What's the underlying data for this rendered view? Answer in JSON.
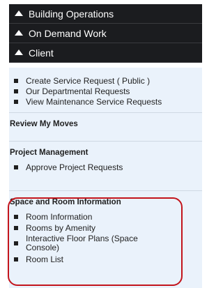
{
  "menus": [
    {
      "label": "Building Operations"
    },
    {
      "label": "On Demand Work"
    },
    {
      "label": "Client"
    }
  ],
  "client_items": [
    {
      "label": "Create Service Request ( Public )"
    },
    {
      "label": "Our Departmental Requests"
    },
    {
      "label": "View Maintenance Service Requests"
    }
  ],
  "sections": {
    "review_moves": {
      "title": "Review My Moves"
    },
    "project_management": {
      "title": "Project Management",
      "items": [
        {
          "label": "Approve Project Requests"
        }
      ]
    },
    "space_room": {
      "title": "Space and Room Information",
      "items": [
        {
          "label": "Room Information"
        },
        {
          "label": "Rooms by Amenity"
        },
        {
          "label": "Interactive Floor Plans (Space Console)"
        },
        {
          "label": "Room List"
        }
      ]
    }
  },
  "colors": {
    "menu_bg": "#1b1c1f",
    "panel_bg": "#eaf2fb",
    "highlight": "#c3141b"
  }
}
